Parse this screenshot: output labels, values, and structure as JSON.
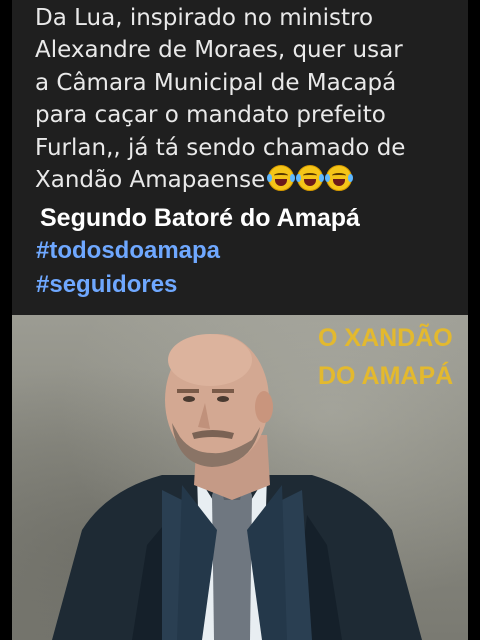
{
  "post": {
    "body_lines": [
      "Da Lua, inspirado no ministro",
      "Alexandre de Moraes, quer usar",
      "a Câmara Municipal de Macapá",
      "para caçar o mandato prefeito",
      "Furlan,, já tá sendo chamado de",
      "Xandão Amapaense"
    ],
    "emojis": [
      "face-with-tears-of-joy-icon",
      "face-with-tears-of-joy-icon",
      "face-with-tears-of-joy-icon"
    ],
    "credit": "Segundo Batoré do Amapá",
    "hashtags": [
      "#todosdoamapa",
      "#seguidores"
    ]
  },
  "photo": {
    "overlay_lines": [
      "O XANDÃO",
      "DO AMAPÁ"
    ]
  }
}
